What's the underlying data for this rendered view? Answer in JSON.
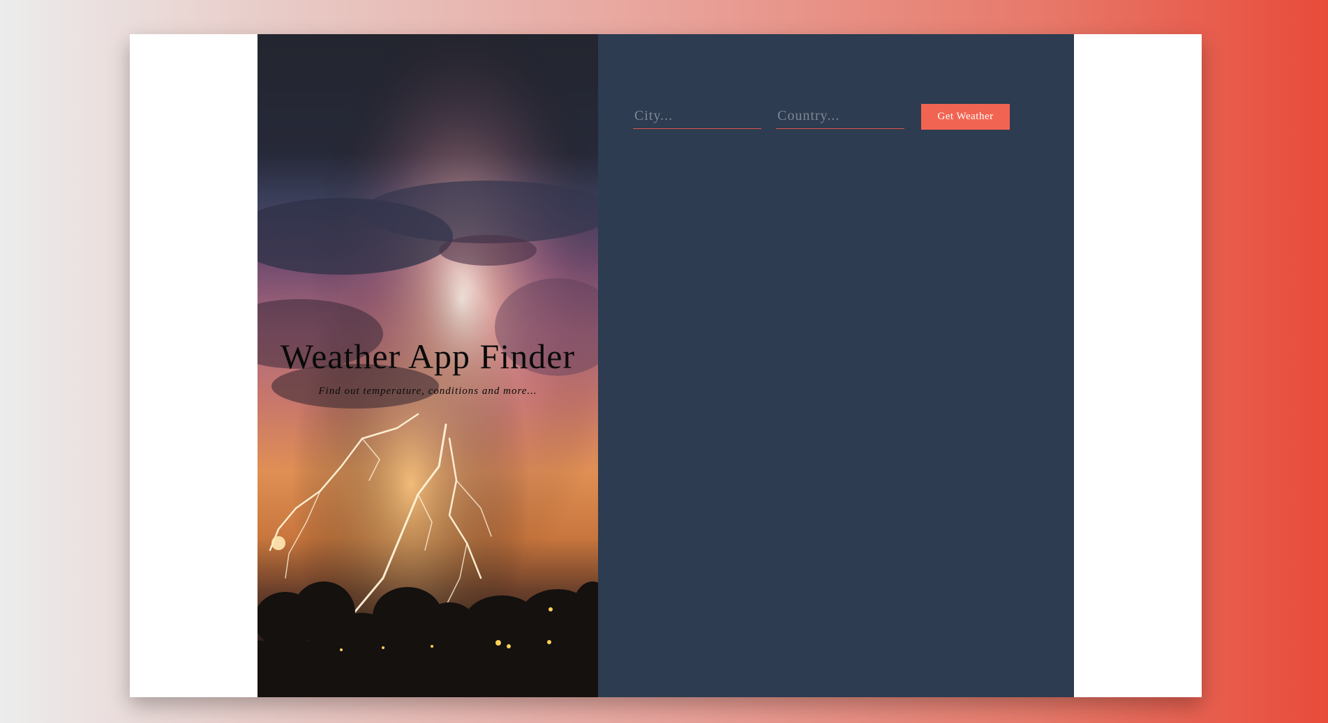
{
  "title_panel": {
    "title": "Weather App Finder",
    "subtitle": "Find out temperature, conditions and more..."
  },
  "form": {
    "city_placeholder": "City...",
    "city_value": "",
    "country_placeholder": "Country...",
    "country_value": "",
    "submit_label": "Get Weather"
  },
  "colors": {
    "form_panel_bg": "#2d3c50",
    "accent": "#f26452",
    "page_gradient_start": "#ececec",
    "page_gradient_end": "#e84b3a"
  }
}
